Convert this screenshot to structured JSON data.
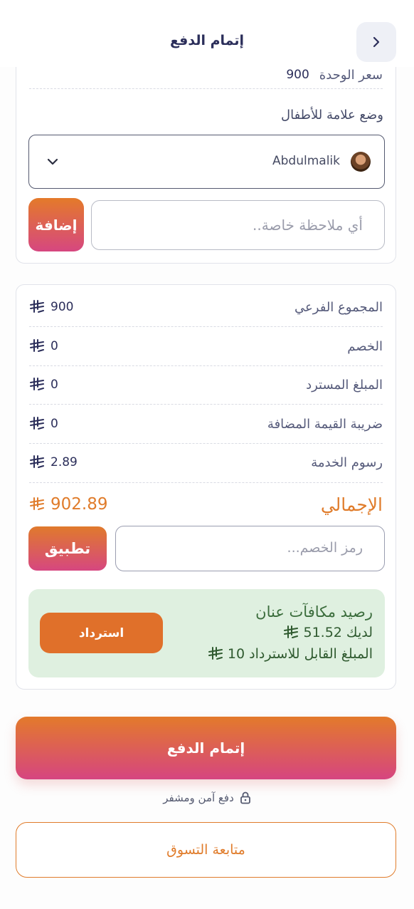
{
  "header": {
    "title": "إتمام الدفع"
  },
  "item": {
    "unit_price_label": "سعر الوحدة",
    "unit_price_value": "900",
    "kid_label": "وضع علامة للأطفال",
    "kid_selected": "Abdulmalik",
    "note_placeholder": "أي ملاحظة خاصة..",
    "add_label": "إضافة"
  },
  "summary": {
    "rows": [
      {
        "label": "المجموع الفرعي",
        "value": "900"
      },
      {
        "label": "الخصم",
        "value": "0"
      },
      {
        "label": "المبلغ المسترد",
        "value": "0"
      },
      {
        "label": "ضريبة القيمة المضافة",
        "value": "0"
      },
      {
        "label": "رسوم الخدمة",
        "value": "2.89"
      }
    ],
    "total_label": "الإجمالي",
    "total_value": "902.89",
    "promo_placeholder": "رمز الخصم...",
    "apply_label": "تطبيق"
  },
  "rewards": {
    "title": "رصيد مكافآت عنان",
    "balance_text": "لديك 51.52",
    "redeemable_text": "المبلغ القابل للاسترداد 10",
    "redeem_label": "استرداد"
  },
  "footer": {
    "checkout_label": "إتمام الدفع",
    "secure_text": "دفع آمن ومشفر",
    "continue_label": "متابعة التسوق"
  },
  "colors": {
    "accent_orange": "#e07c2b",
    "accent_pink": "#d64780",
    "text_navy": "#2b2e5a",
    "rewards_bg": "#dff0e0"
  },
  "icons": [
    "chevron-left-icon",
    "chevron-down-icon",
    "riyal-icon",
    "lock-icon",
    "avatar"
  ]
}
